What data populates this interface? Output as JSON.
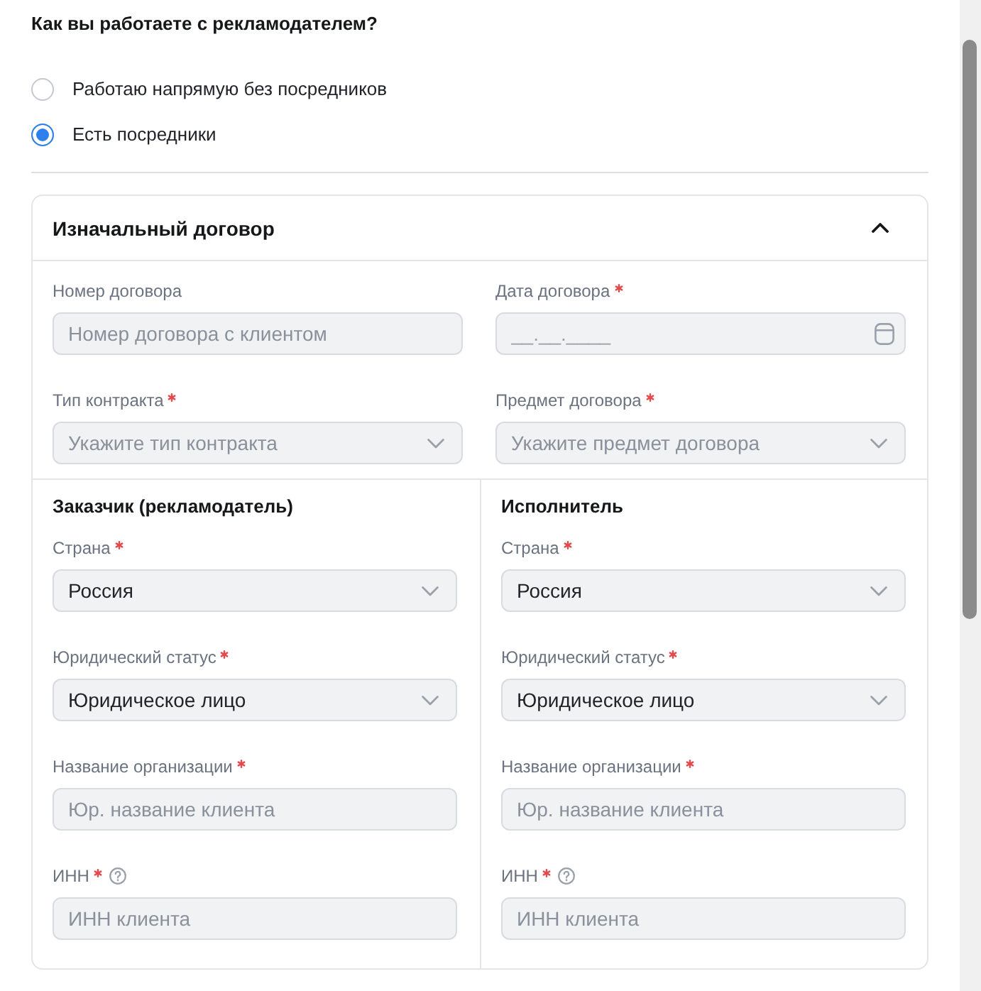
{
  "question": {
    "title": "Как вы работаете с рекламодателем?",
    "options": [
      {
        "label": "Работаю напрямую без посредников",
        "selected": false
      },
      {
        "label": "Есть посредники",
        "selected": true
      }
    ]
  },
  "contract": {
    "title": "Изначальный договор",
    "expanded": true,
    "fields": [
      {
        "kind": "text",
        "label": "Номер договора",
        "placeholder": "Номер договора с клиентом"
      },
      {
        "kind": "date",
        "label": "Дата договора",
        "required": true,
        "placeholder": "__.__.____"
      },
      {
        "kind": "select",
        "label": "Тип контракта",
        "required": true,
        "placeholder": "Укажите тип контракта"
      },
      {
        "kind": "select",
        "label": "Предмет договора",
        "required": true,
        "placeholder": "Укажите предмет договора"
      }
    ],
    "parties": [
      {
        "title": "Заказчик (рекламодатель)",
        "fields": [
          {
            "kind": "select",
            "label": "Страна",
            "required": true,
            "value": "Россия"
          },
          {
            "kind": "select",
            "label": "Юридический статус",
            "required": true,
            "value": "Юридическое лицо"
          },
          {
            "kind": "text",
            "label": "Название организации",
            "required": true,
            "placeholder": "Юр. название клиента"
          },
          {
            "kind": "text",
            "label": "ИНН",
            "required": true,
            "help": true,
            "placeholder": "ИНН клиента"
          }
        ]
      },
      {
        "title": "Исполнитель",
        "fields": [
          {
            "kind": "select",
            "label": "Страна",
            "required": true,
            "value": "Россия"
          },
          {
            "kind": "select",
            "label": "Юридический статус",
            "required": true,
            "value": "Юридическое лицо"
          },
          {
            "kind": "text",
            "label": "Название организации",
            "required": true,
            "placeholder": "Юр. название клиента"
          },
          {
            "kind": "text",
            "label": "ИНН",
            "required": true,
            "help": true,
            "placeholder": "ИНН клиента"
          }
        ]
      }
    ]
  }
}
